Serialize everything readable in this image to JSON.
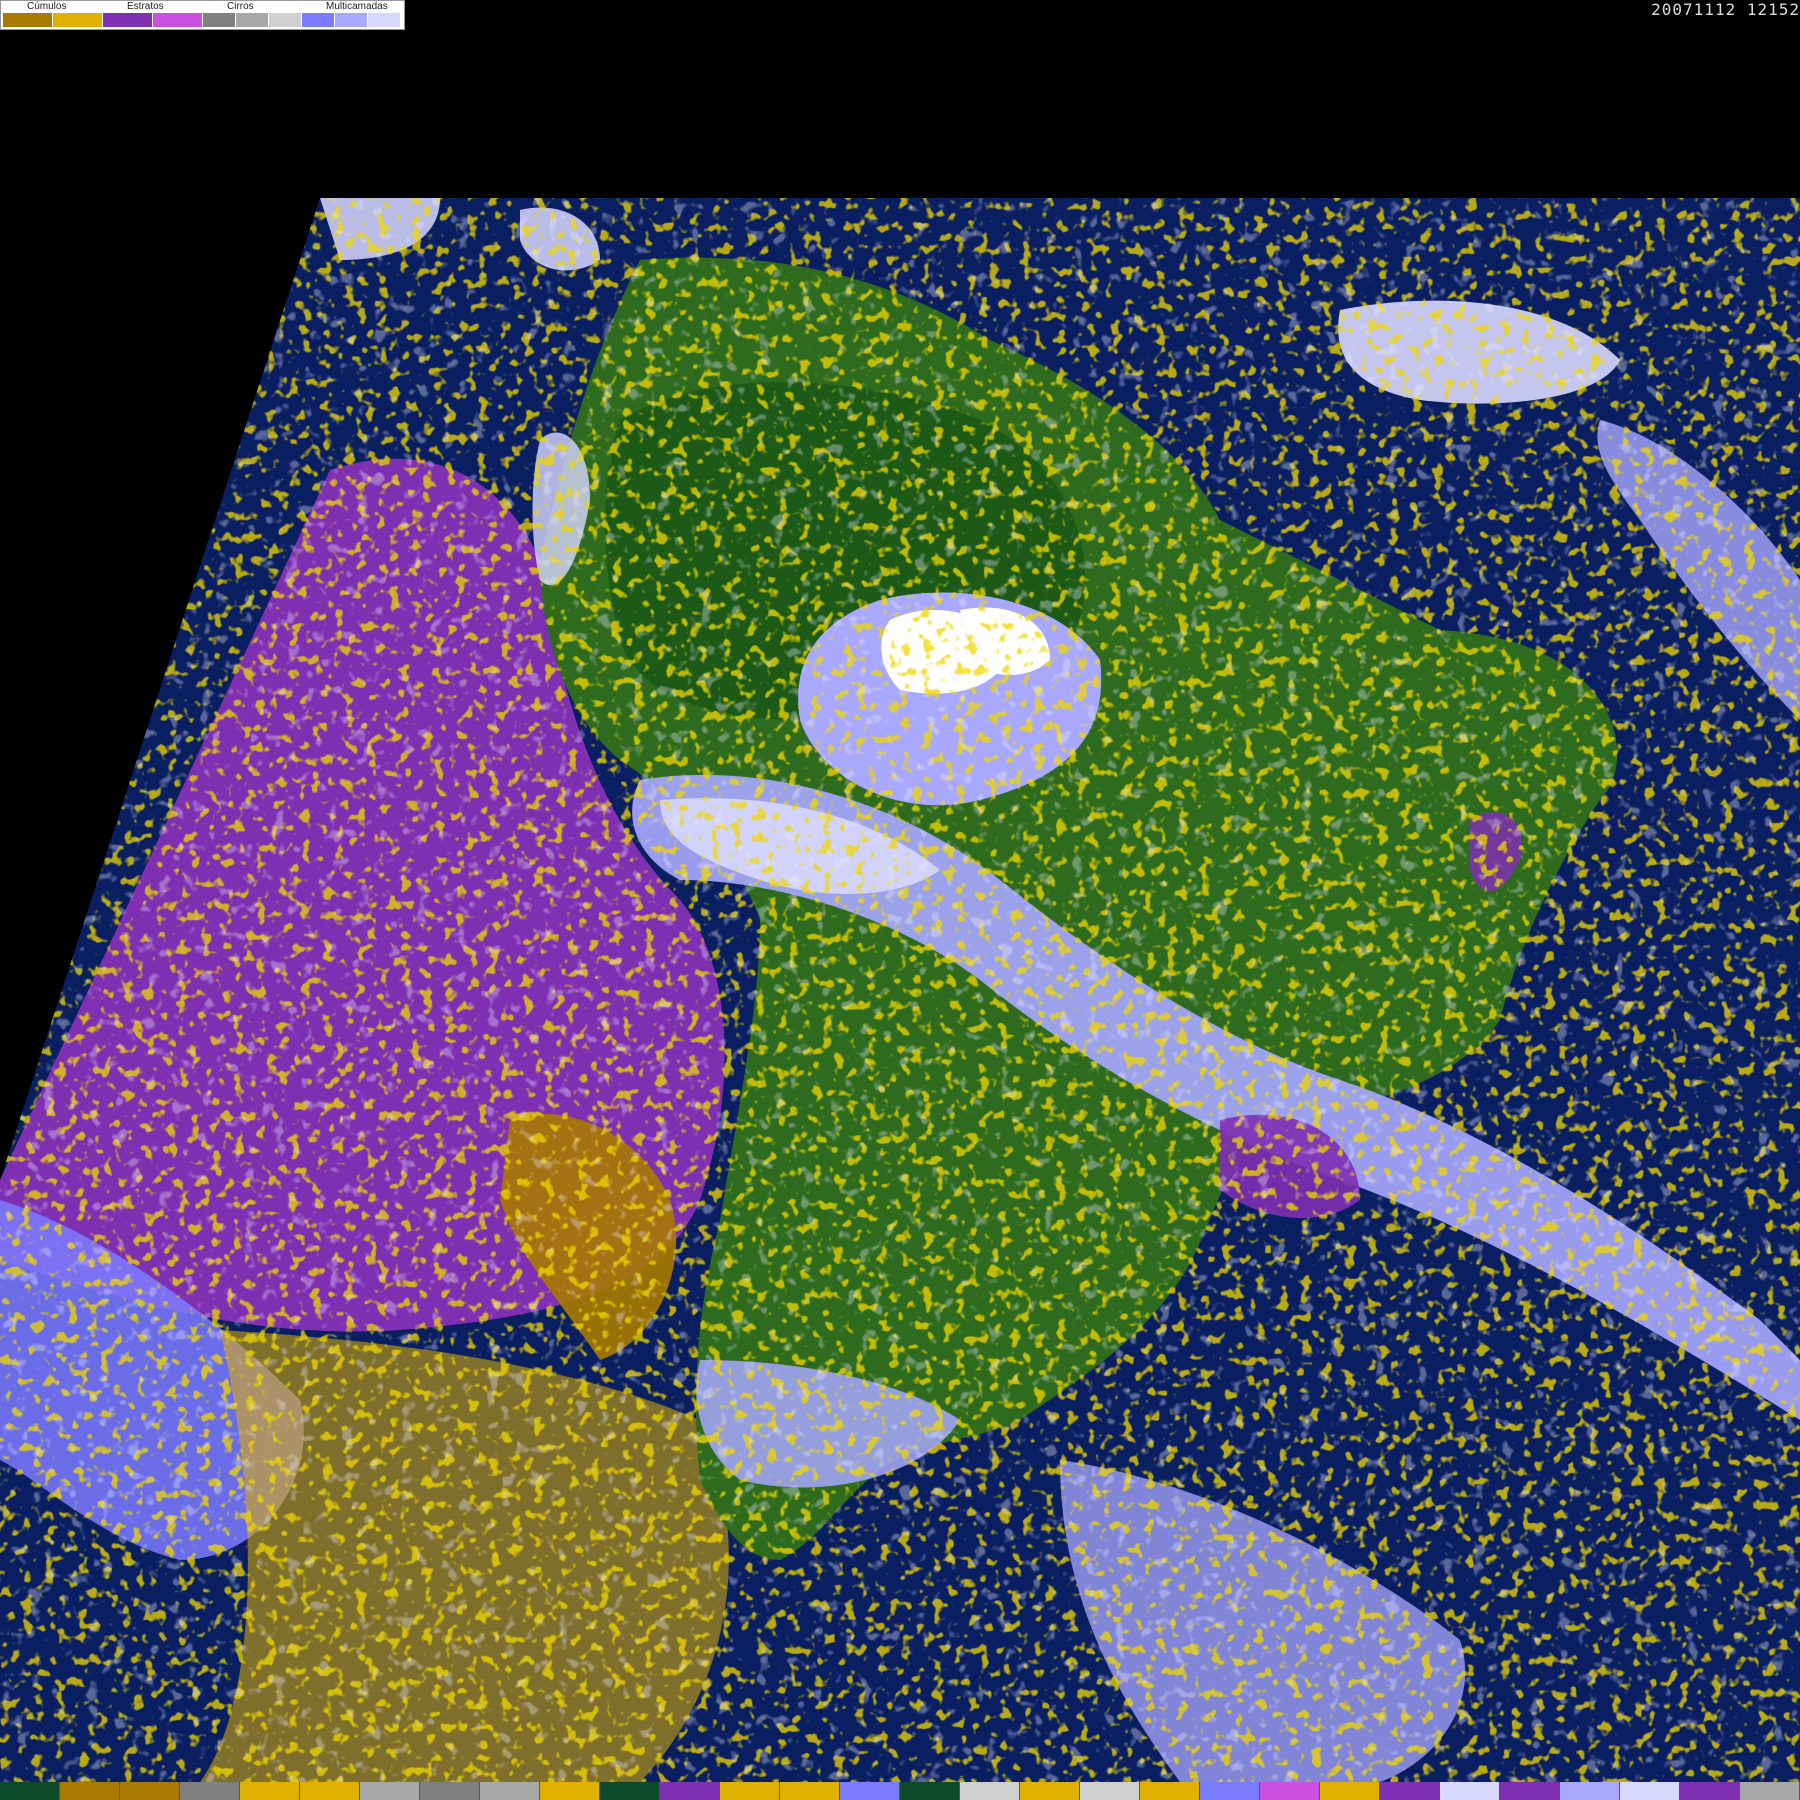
{
  "legend": {
    "groups": [
      {
        "label": "Cúmulos",
        "colors": [
          "#a87a00",
          "#e0b000"
        ]
      },
      {
        "label": "Estratos",
        "colors": [
          "#7f2fb2",
          "#cc50e0"
        ]
      },
      {
        "label": "Cirros",
        "colors": [
          "#808080",
          "#a8a8a8",
          "#d0d0d0"
        ]
      },
      {
        "label": "Multicamadas",
        "colors": [
          "#7b7bff",
          "#a8a8ff",
          "#d8d8ff"
        ]
      }
    ]
  },
  "timestamp": "20071112 12152",
  "colors": {
    "ocean": "#0a1f62",
    "land": "#2f6b1e",
    "forest": "#1d5a18",
    "stratus": "#7f2fb2",
    "cumulus_dark": "#a87a00",
    "cumulus_light": "#e0b000",
    "multilayer": "#a8a8ff",
    "cirrus": "#d8d8ff"
  },
  "bottom_bar": [
    "#0d4a2a",
    "#a87a00",
    "#a87a00",
    "#808080",
    "#e0b000",
    "#e0b000",
    "#a8a8a8",
    "#808080",
    "#a8a8a8",
    "#e0b000",
    "#0d4a2a",
    "#7f2fb2",
    "#e0b000",
    "#e0b000",
    "#7b7bff",
    "#0d4a2a",
    "#d0d0d0",
    "#e0b000",
    "#d0d0d0",
    "#e0b000",
    "#7b7bff",
    "#cc50e0",
    "#e0b000",
    "#7f2fb2",
    "#d8d8ff",
    "#7f2fb2",
    "#a8a8ff",
    "#d8d8ff",
    "#7f2fb2",
    "#a8a8a8"
  ]
}
